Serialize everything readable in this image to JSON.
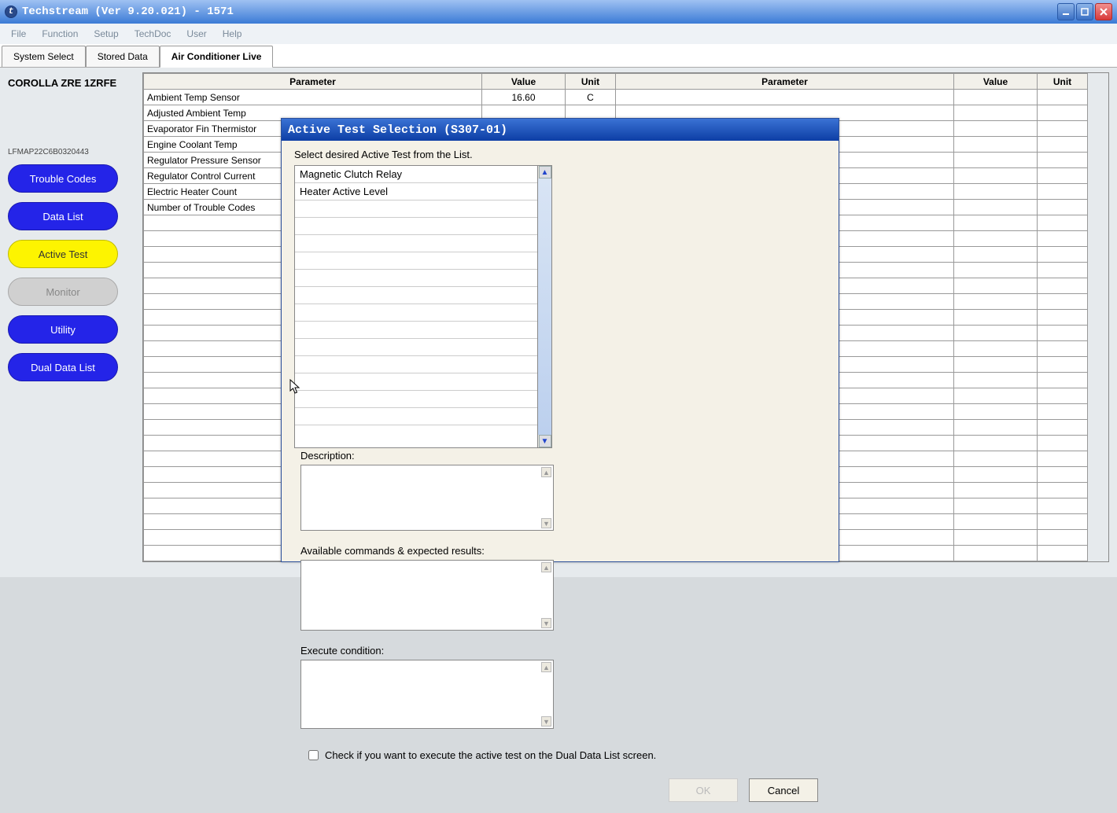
{
  "titlebar": {
    "text": "Techstream (Ver 9.20.021) - 1571"
  },
  "menu": [
    "File",
    "Function",
    "Setup",
    "TechDoc",
    "User",
    "Help"
  ],
  "tabs": {
    "items": [
      "System Select",
      "Stored Data",
      "Air Conditioner Live"
    ],
    "active_index": 2
  },
  "vehicle": {
    "name": "COROLLA ZRE 1ZRFE",
    "code": "LFMAP22C6B0320443"
  },
  "side_buttons": [
    {
      "label": "Trouble Codes",
      "style": "blue"
    },
    {
      "label": "Data List",
      "style": "blue"
    },
    {
      "label": "Active Test",
      "style": "yellow"
    },
    {
      "label": "Monitor",
      "style": "disabled"
    },
    {
      "label": "Utility",
      "style": "blue"
    },
    {
      "label": "Dual Data List",
      "style": "blue"
    }
  ],
  "table": {
    "headers": [
      "Parameter",
      "Value",
      "Unit",
      "Parameter",
      "Value",
      "Unit"
    ],
    "rows": [
      {
        "p": "Ambient Temp Sensor",
        "v": "16.60",
        "u": "C"
      },
      {
        "p": "Adjusted Ambient Temp",
        "v": "",
        "u": ""
      },
      {
        "p": "Evaporator Fin Thermistor",
        "v": "",
        "u": ""
      },
      {
        "p": "Engine Coolant Temp",
        "v": "",
        "u": ""
      },
      {
        "p": "Regulator Pressure Sensor",
        "v": "",
        "u": ""
      },
      {
        "p": "Regulator Control Current",
        "v": "",
        "u": ""
      },
      {
        "p": "Electric Heater Count",
        "v": "",
        "u": ""
      },
      {
        "p": "Number of Trouble Codes",
        "v": "",
        "u": ""
      }
    ],
    "blank_rows": 22
  },
  "dialog": {
    "title": "Active Test Selection (S307-01)",
    "instruction": "Select desired Active Test from the List.",
    "list_items": [
      "Magnetic Clutch Relay",
      "Heater Active Level"
    ],
    "list_blank_rows": 13,
    "label_description": "Description:",
    "label_commands": "Available commands & expected results:",
    "label_exec": "Execute condition:",
    "checkbox_label": "Check if you want to execute the active test on the Dual Data List screen.",
    "ok_label": "OK",
    "cancel_label": "Cancel"
  }
}
